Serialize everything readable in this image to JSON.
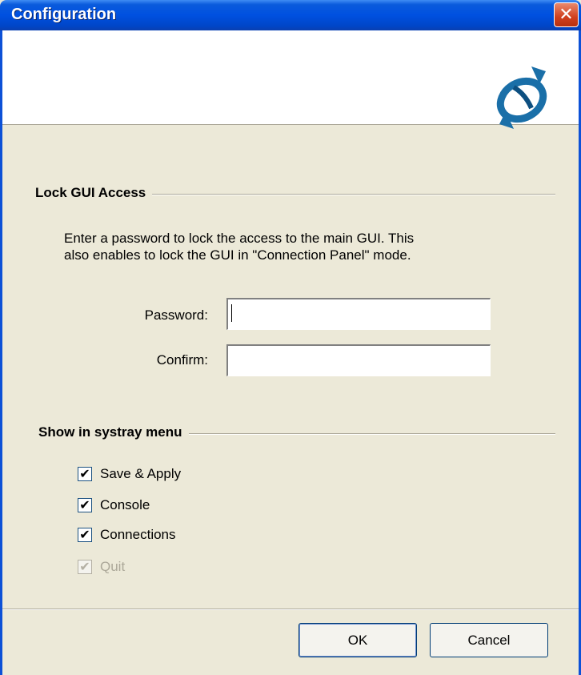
{
  "window": {
    "title": "Configuration"
  },
  "lock_section": {
    "heading": "Lock GUI Access",
    "description_line1": "Enter a password to lock the access to the main GUI. This",
    "description_line2": "also enables to lock the GUI in \"Connection Panel\" mode.",
    "password_label": "Password:",
    "password_value": "",
    "confirm_label": "Confirm:",
    "confirm_value": ""
  },
  "systray_section": {
    "heading": "Show in systray menu",
    "items": [
      {
        "label": "Save & Apply",
        "checked": true,
        "enabled": true
      },
      {
        "label": "Console",
        "checked": true,
        "enabled": true
      },
      {
        "label": "Connections",
        "checked": true,
        "enabled": true
      },
      {
        "label": "Quit",
        "checked": true,
        "enabled": false
      }
    ]
  },
  "buttons": {
    "ok": "OK",
    "cancel": "Cancel"
  },
  "icons": {
    "close": "close-icon",
    "logo": "app-logo-icon",
    "check": "checkmark-icon"
  },
  "colors": {
    "titlebar": "#0050e0",
    "dialog_bg": "#ece9d8",
    "logo": "#1a6fa8",
    "close": "#d0401e"
  }
}
